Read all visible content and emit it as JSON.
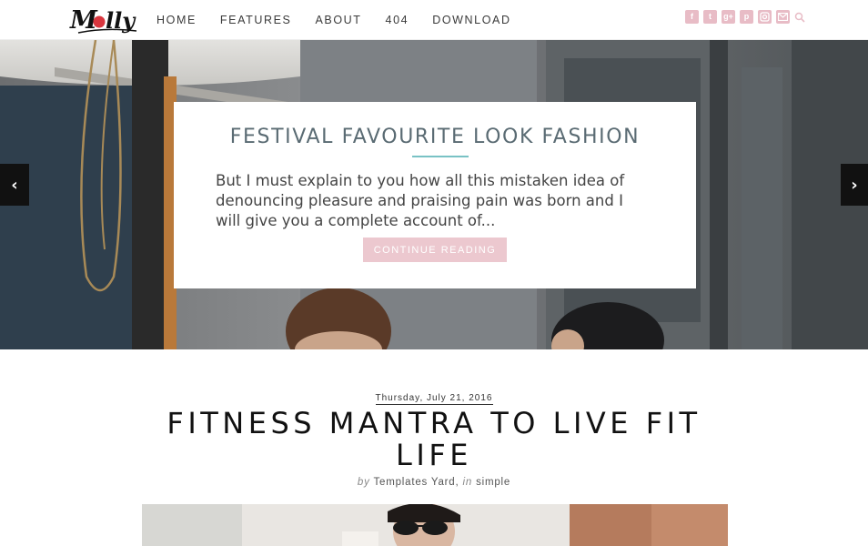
{
  "brand": {
    "logo_text": "Molly"
  },
  "nav": {
    "items": [
      {
        "label": "HOME"
      },
      {
        "label": "FEATURES"
      },
      {
        "label": "ABOUT"
      },
      {
        "label": "404"
      },
      {
        "label": "DOWNLOAD"
      }
    ]
  },
  "social": {
    "icons": [
      "facebook-icon",
      "twitter-icon",
      "google-plus-icon",
      "pinterest-icon",
      "instagram-icon",
      "email-icon",
      "search-icon"
    ],
    "accent": "#e8bcc6"
  },
  "slider": {
    "prev_symbol": "‹",
    "next_symbol": "›",
    "slide": {
      "title": "FESTIVAL FAVOURITE LOOK FASHION",
      "excerpt": "But I must explain to you how all this mistaken idea of denouncing pleasure and praising pain was born and I will give you a complete account of...",
      "button_label": "CONTINUE READING"
    }
  },
  "post": {
    "date": "Thursday, July 21, 2016",
    "title": "FITNESS MANTRA TO LIVE FIT LIFE",
    "by_label": "by",
    "author": "Templates Yard,",
    "in_label": "in",
    "category": "simple"
  },
  "colors": {
    "button_pink": "#ecc8cf",
    "title_slate": "#5a6b73",
    "rule_teal": "#79c2c5"
  }
}
